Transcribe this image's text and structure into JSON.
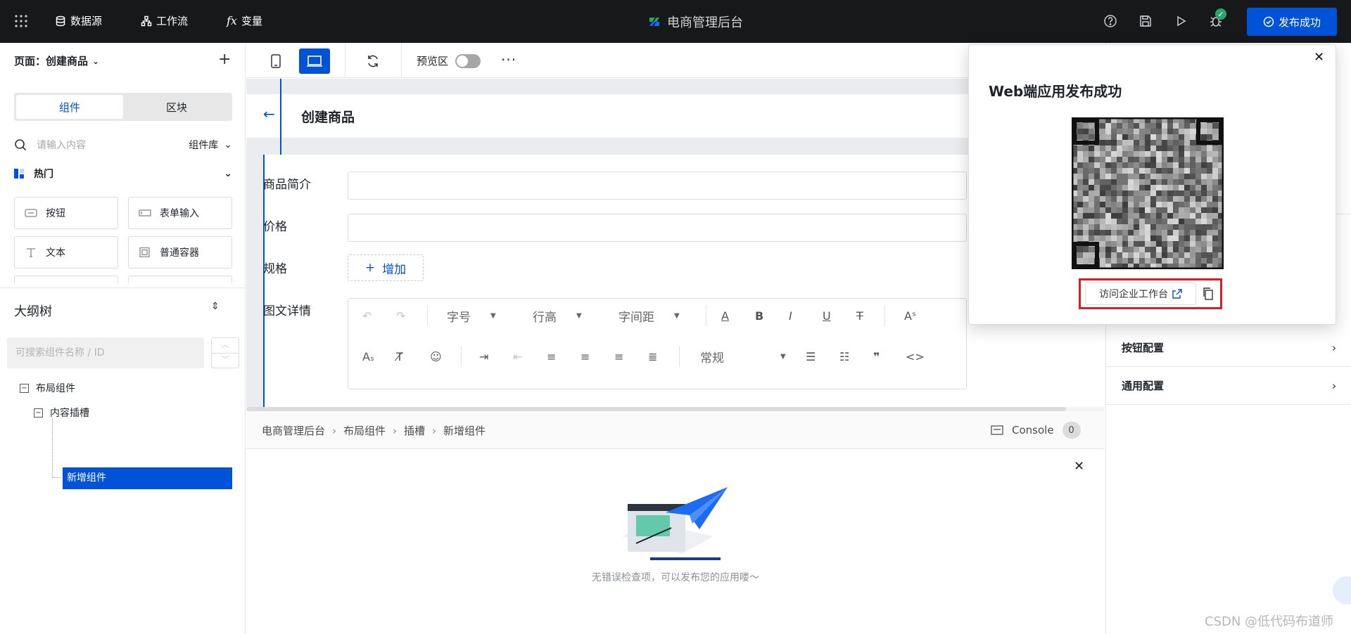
{
  "topbar": {
    "nav": [
      {
        "label": "数据源",
        "icon": "database-icon"
      },
      {
        "label": "工作流",
        "icon": "workflow-icon"
      },
      {
        "label": "变量",
        "icon": "function-icon"
      }
    ],
    "app_title": "电商管理后台",
    "tools": [
      "help-icon",
      "save-icon",
      "play-icon",
      "bug-icon"
    ],
    "publish_label": "发布成功",
    "accent": "#0052d9"
  },
  "left": {
    "page_label": "页面：创建商品",
    "tabs": [
      "组件",
      "区块"
    ],
    "search_placeholder": "请输入内容",
    "library_label": "组件库",
    "category": "热门",
    "components": [
      {
        "label": "按钮",
        "icon": "button-icon"
      },
      {
        "label": "表单输入",
        "icon": "input-icon"
      },
      {
        "label": "文本",
        "icon": "text-icon"
      },
      {
        "label": "普通容器",
        "icon": "container-icon"
      }
    ],
    "outline_title": "大纲树",
    "outline_search_placeholder": "可搜索组件名称 / ID",
    "tree": [
      "布局组件",
      "内容插槽",
      "新增组件"
    ]
  },
  "toolbar": {
    "preview_label": "预览区"
  },
  "canvas": {
    "page_title": "创建商品",
    "fields": [
      "商品简介",
      "价格",
      "规格",
      "图文详情"
    ],
    "add_label": "增加",
    "editor": {
      "font_size": "字号",
      "line_height": "行高",
      "letter_spacing": "字间距",
      "paragraph": "常规"
    }
  },
  "bottom": {
    "breadcrumb": [
      "电商管理后台",
      "布局组件",
      "插槽",
      "新增组件"
    ],
    "console_label": "Console",
    "console_count": "0",
    "empty_text": "无错误检查项，可以发布您的应用喽～"
  },
  "right": {
    "rows": [
      "按钮配置",
      "通用配置"
    ]
  },
  "popup": {
    "title": "Web端应用发布成功",
    "visit_label": "访问企业工作台",
    "highlight_color": "#d42128"
  },
  "watermark": "CSDN @低代码布道师"
}
